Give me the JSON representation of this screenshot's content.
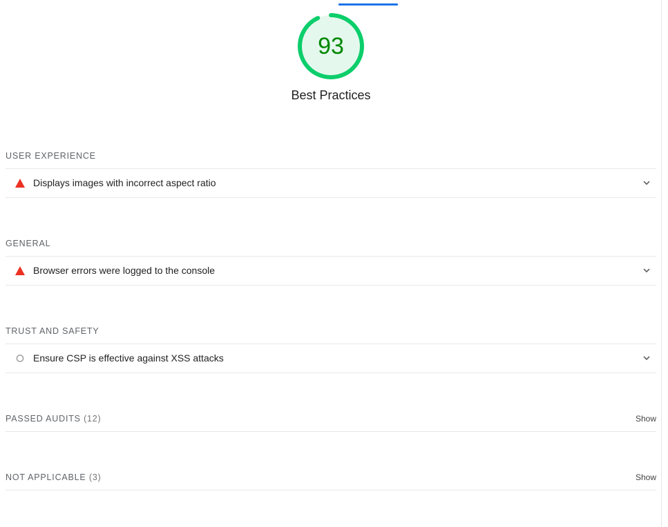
{
  "score": {
    "value": "93",
    "fraction": 0.93,
    "title": "Best Practices",
    "ring_color": "#0cce6b",
    "fill_color": "#e5f8ee",
    "text_color": "#008800"
  },
  "tab_indicator_color": "#1a73e8",
  "groups": {
    "user_experience": {
      "title": "USER EXPERIENCE",
      "audit": {
        "label": "Displays images with incorrect aspect ratio",
        "status": "fail",
        "icon": "warning-triangle-icon"
      }
    },
    "general": {
      "title": "GENERAL",
      "audit": {
        "label": "Browser errors were logged to the console",
        "status": "fail",
        "icon": "warning-triangle-icon"
      }
    },
    "trust_safety": {
      "title": "TRUST AND SAFETY",
      "audit": {
        "label": "Ensure CSP is effective against XSS attacks",
        "status": "manual",
        "icon": "circle-outline-icon"
      }
    },
    "passed": {
      "title": "PASSED AUDITS",
      "count": "(12)",
      "toggle": "Show"
    },
    "not_applicable": {
      "title": "NOT APPLICABLE",
      "count": "(3)",
      "toggle": "Show"
    }
  },
  "colors": {
    "fail": "#eb3223",
    "neutral": "#9e9e9e"
  }
}
